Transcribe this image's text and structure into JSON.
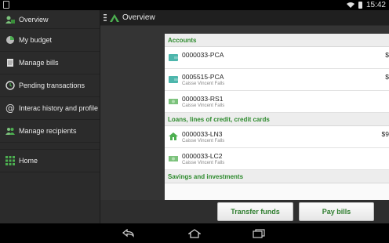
{
  "status_bar": {
    "time": "15:42",
    "icons": [
      "notification-icon",
      "wifi-icon",
      "battery-icon"
    ]
  },
  "action_bar": {
    "title": "Overview"
  },
  "drawer": {
    "items": [
      {
        "label": "Overview",
        "icon": "overview-icon"
      },
      {
        "label": "My budget",
        "icon": "pie-chart-icon"
      },
      {
        "label": "Manage bills",
        "icon": "bills-icon"
      },
      {
        "label": "Pending transactions",
        "icon": "clock-icon"
      },
      {
        "label": "Interac history and profile",
        "icon": "at-icon"
      },
      {
        "label": "Manage recipients",
        "icon": "people-icon"
      },
      {
        "label": "Home",
        "icon": "grid-icon"
      }
    ]
  },
  "sections": [
    {
      "title": "Accounts",
      "rows": [
        {
          "number": "0000033-PCA",
          "institution": "",
          "amount": "$",
          "icon": "wallet-icon"
        },
        {
          "number": "0005515-PCA",
          "institution": "Caisse Vincent Falls",
          "amount": "$",
          "icon": "wallet-icon"
        },
        {
          "number": "0000033-RS1",
          "institution": "Caisse Vincent Falls",
          "amount": "",
          "icon": "cash-icon"
        }
      ]
    },
    {
      "title": "Loans, lines of credit, credit cards",
      "rows": [
        {
          "number": "0000033-LN3",
          "institution": "Caisse Vincent Falls",
          "amount": "$9",
          "icon": "house-icon"
        },
        {
          "number": "0000033-LC2",
          "institution": "Caisse Vincent Falls",
          "amount": "",
          "icon": "cash-icon"
        }
      ]
    },
    {
      "title": "Savings and investments",
      "rows": []
    }
  ],
  "buttons": {
    "transfer": "Transfer funds",
    "pay": "Pay bills"
  },
  "colors": {
    "accent_green": "#2e8b2e",
    "drawer_bg": "#2b2b2b",
    "content_bg": "#343434"
  }
}
